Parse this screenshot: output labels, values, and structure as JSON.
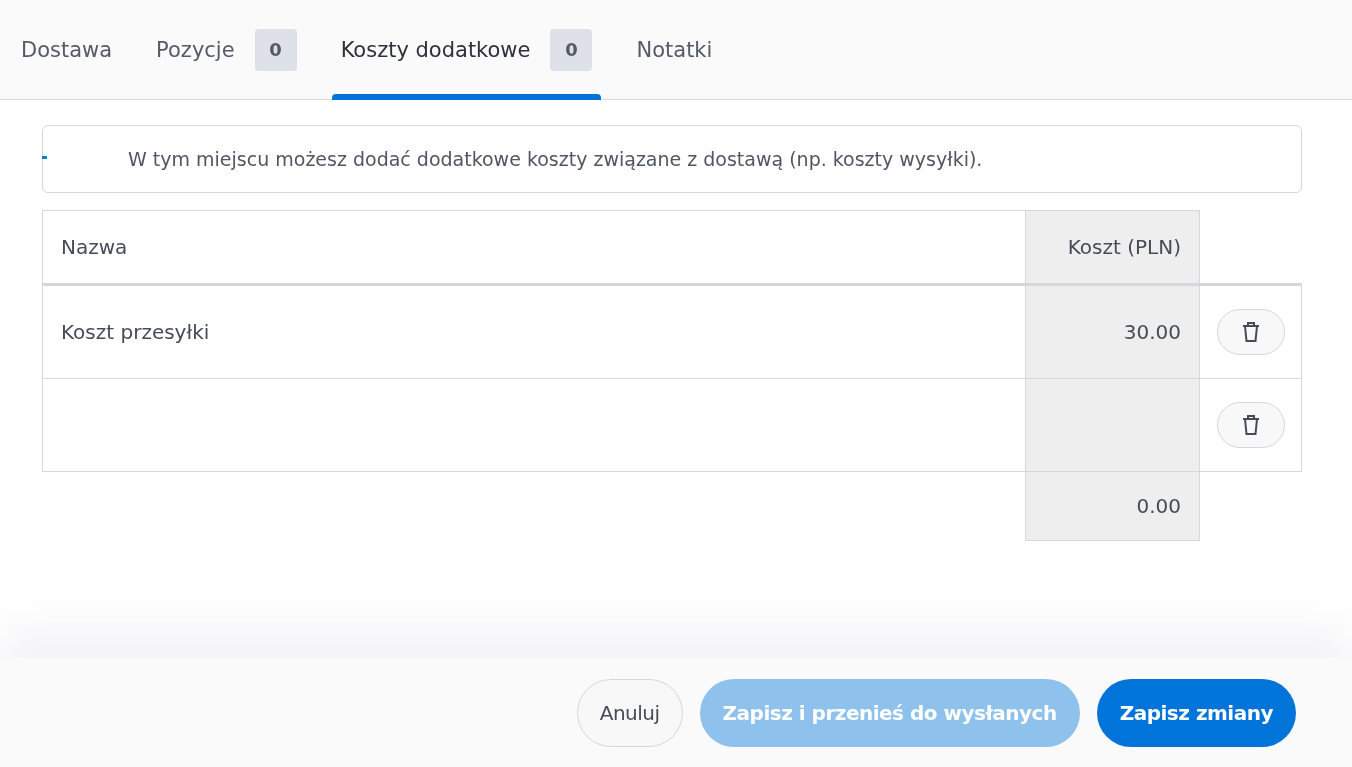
{
  "tabs": [
    {
      "label": "Dostawa",
      "selected": false
    },
    {
      "label": "Pozycje",
      "count": "0",
      "selected": false
    },
    {
      "label": "Koszty dodatkowe",
      "count": "0",
      "selected": true
    },
    {
      "label": "Notatki",
      "selected": false
    }
  ],
  "info": "W tym miejscu możesz dodać dodatkowe koszty związane z dostawą (np. koszty wysyłki).",
  "table": {
    "columns": [
      "Nazwa",
      "Koszt (PLN)"
    ],
    "rows": [
      {
        "name": "Koszt przesyłki",
        "cost": "30.00"
      },
      {}
    ],
    "total": "0.00"
  },
  "buttons": [
    {
      "label": "Anuluj",
      "kind": "secondary",
      "disabled": false
    },
    {
      "label": "Zapisz i przenieś do wysłanych",
      "kind": "primary",
      "disabled": true
    },
    {
      "label": "Zapisz zmiany",
      "kind": "primary",
      "disabled": false
    }
  ]
}
